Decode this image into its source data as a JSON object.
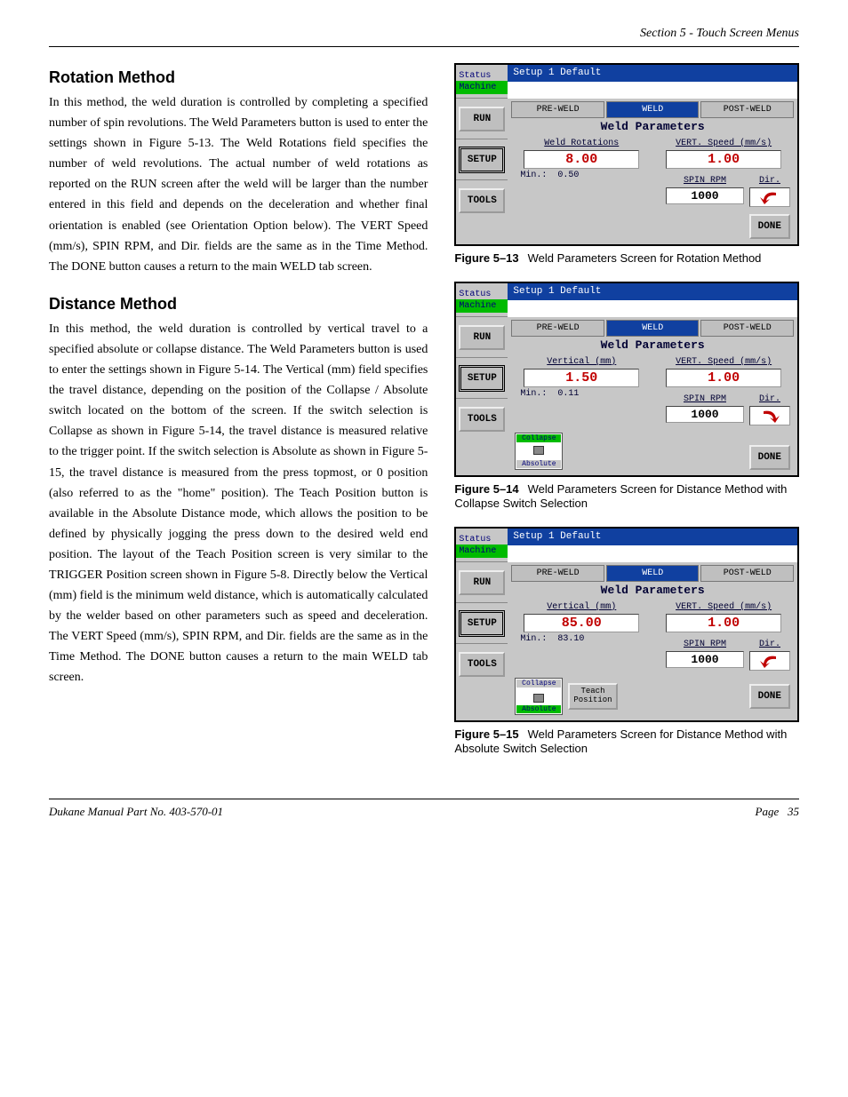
{
  "header": {
    "section": "Section 5 - Touch Screen Menus"
  },
  "footer": {
    "left": "Dukane Manual Part No. 403-570-01",
    "right_label": "Page",
    "right_num": "35"
  },
  "h1": "Rotation Method",
  "p1": "In this method, the weld duration is controlled by completing a specified number of spin revolutions. The Weld Parameters button is used to enter the settings shown in Figure 5-13. The Weld Rotations field specifies the number of weld revolutions. The actual number of weld rotations as reported on the RUN screen after the weld will be larger than the number entered in this field and depends on the deceleration and whether final orientation is enabled (see Orientation Option below). The VERT Speed (mm/s), SPIN RPM, and Dir. fields are the same as in the Time Method. The DONE button causes a return to the main WELD tab screen.",
  "h2": "Distance Method",
  "p2": "In this method, the weld duration is controlled by vertical travel to a specified absolute or collapse distance. The Weld Parameters button is used to enter the settings shown in Figure 5-14. The Vertical (mm) field specifies the travel distance, depending on the position of the Collapse / Absolute switch located on the bottom of the screen. If the switch selection is Collapse as shown in Figure 5-14, the travel distance is measured relative to the trigger point. If the switch selection is Absolute as shown in Figure 5-15, the travel distance is measured from the press topmost, or 0 position (also referred to as the \"home\" position). The Teach Position button is available in the Absolute Distance mode, which allows the position to be defined by physically jogging the press down to the desired weld end position. The layout of the Teach Position screen is very similar to the TRIGGER Position screen shown in Figure 5-8. Directly below the Vertical (mm) field is the minimum weld distance, which is automatically calculated by the welder based on other parameters such as speed and deceleration. The VERT Speed (mm/s), SPIN RPM, and Dir. fields are the same as in the Time Method.  The DONE button causes a return to the main WELD tab screen.",
  "common": {
    "status": "Status",
    "machine": "Machine",
    "titlebar": "Setup 1   Default",
    "tabs": {
      "pre": "PRE-WELD",
      "weld": "WELD",
      "post": "POST-WELD"
    },
    "subtitle": "Weld Parameters",
    "run": "RUN",
    "setup": "SETUP",
    "tools": "TOOLS",
    "done": "DONE",
    "vspeed_label": "VERT. Speed (mm/s)",
    "spin_label": "SPIN RPM",
    "dir_label": "Dir.",
    "min_label": "Min.:",
    "collapse": "Collapse",
    "absolute": "Absolute",
    "teach": "Teach\nPosition"
  },
  "fig13": {
    "param_label": "Weld Rotations",
    "param_val": "8.00",
    "min_val": "0.50",
    "vspeed_val": "1.00",
    "spin_val": "1000",
    "caption_num": "Figure 5–13",
    "caption_txt": "Weld Parameters Screen for Rotation Method"
  },
  "fig14": {
    "param_label": "Vertical (mm)",
    "param_val": "1.50",
    "min_val": "0.11",
    "vspeed_val": "1.00",
    "spin_val": "1000",
    "caption_num": "Figure 5–14",
    "caption_txt": "Weld Parameters Screen for Distance Method with Collapse Switch Selection"
  },
  "fig15": {
    "param_label": "Vertical (mm)",
    "param_val": "85.00",
    "min_val": "83.10",
    "vspeed_val": "1.00",
    "spin_val": "1000",
    "caption_num": "Figure 5–15",
    "caption_txt": "Weld Parameters Screen for Distance Method with Absolute Switch Selection"
  }
}
